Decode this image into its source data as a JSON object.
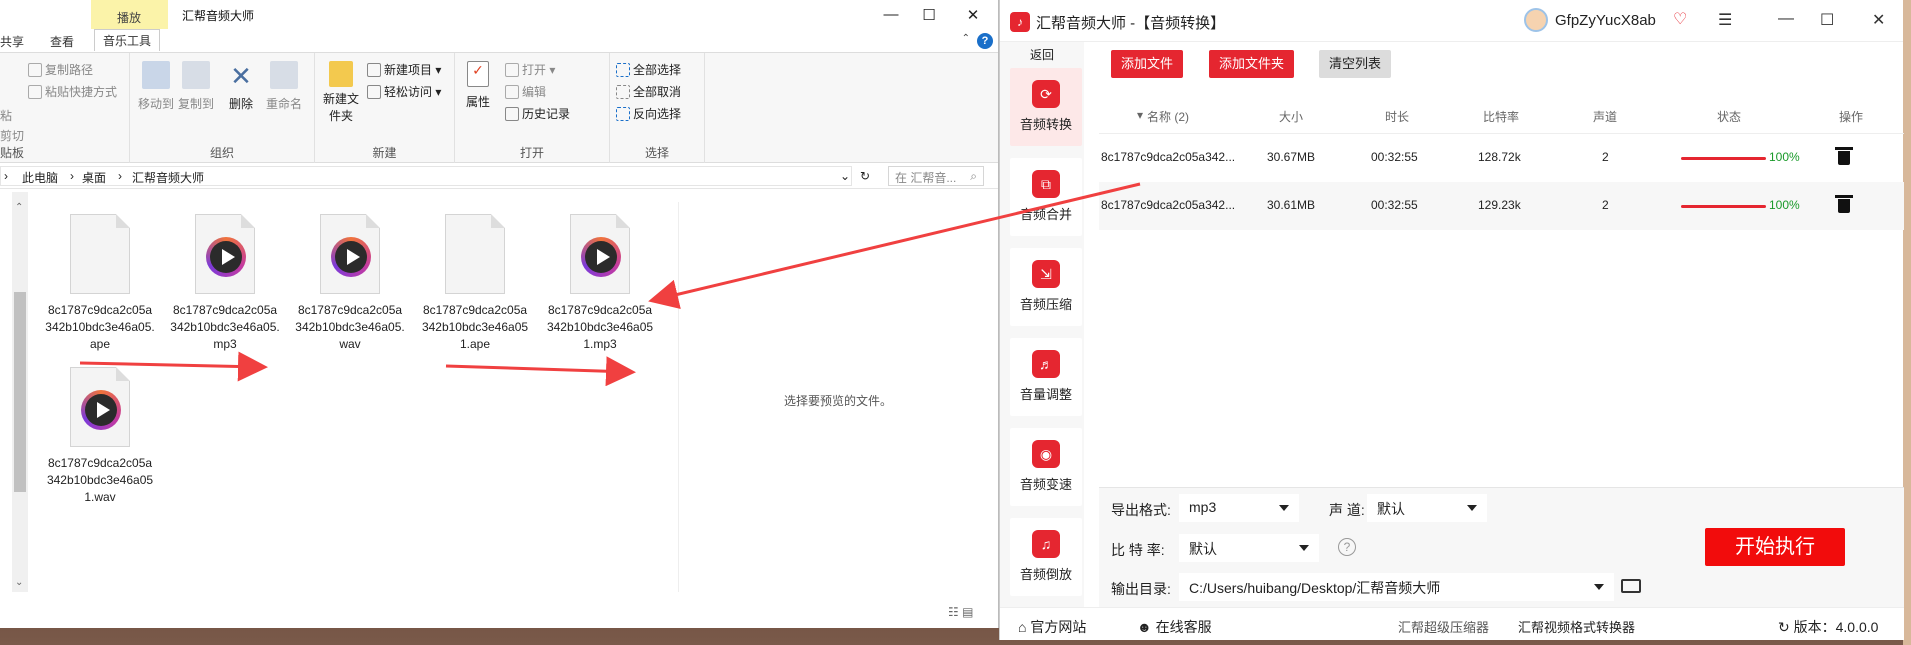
{
  "explorer": {
    "title": "汇帮音频大师",
    "context_tab": "播放",
    "tabs": [
      "共享",
      "查看",
      "音乐工具"
    ],
    "ribbon": {
      "clipboard": {
        "label": "贴板",
        "items": [
          "复制路径",
          "粘贴快捷方式",
          "粘",
          "剪切"
        ]
      },
      "organize": {
        "label": "组织",
        "items": [
          "移动到",
          "复制到",
          "删除",
          "重命名"
        ]
      },
      "new": {
        "label": "新建",
        "items": [
          "新建文件夹",
          "新建项目",
          "轻松访问"
        ]
      },
      "open": {
        "label": "打开",
        "items": [
          "属性",
          "打开",
          "编辑",
          "历史记录"
        ]
      },
      "select": {
        "label": "选择",
        "items": [
          "全部选择",
          "全部取消",
          "反向选择"
        ]
      }
    },
    "breadcrumb": [
      "此电脑",
      "桌面",
      "汇帮音频大师"
    ],
    "search_placeholder": "在 汇帮音...",
    "files": [
      {
        "name": "8c1787c9dca2c05a342b10bdc3e46a05.ape",
        "icon": "generic-file-icon"
      },
      {
        "name": "8c1787c9dca2c05a342b10bdc3e46a05.mp3",
        "icon": "media-play-icon"
      },
      {
        "name": "8c1787c9dca2c05a342b10bdc3e46a05.wav",
        "icon": "media-play-icon"
      },
      {
        "name": "8c1787c9dca2c05a342b10bdc3e46a051.ape",
        "icon": "generic-file-icon"
      },
      {
        "name": "8c1787c9dca2c05a342b10bdc3e46a051.mp3",
        "icon": "media-play-icon"
      },
      {
        "name": "8c1787c9dca2c05a342b10bdc3e46a051.wav",
        "icon": "media-play-icon"
      }
    ],
    "preview_text": "选择要预览的文件。"
  },
  "app": {
    "title": "汇帮音频大师 -【音频转换】",
    "user": "GfpZyYucX8ab",
    "sidebar": {
      "back": "返回",
      "items": [
        {
          "label": "音频转换",
          "active": true
        },
        {
          "label": "音频合并",
          "active": false
        },
        {
          "label": "音频压缩",
          "active": false
        },
        {
          "label": "音量调整",
          "active": false
        },
        {
          "label": "音频变速",
          "active": false
        },
        {
          "label": "音频倒放",
          "active": false
        }
      ]
    },
    "toolbar": {
      "add_file": "添加文件",
      "add_folder": "添加文件夹",
      "clear": "清空列表"
    },
    "table": {
      "headers": [
        "名称 (2)",
        "大小",
        "时长",
        "比特率",
        "声道",
        "状态",
        "操作"
      ],
      "rows": [
        {
          "name": "8c1787c9dca2c05a342...",
          "size": "30.67MB",
          "duration": "00:32:55",
          "bitrate": "128.72k",
          "channels": "2",
          "progress": "100%"
        },
        {
          "name": "8c1787c9dca2c05a342...",
          "size": "30.61MB",
          "duration": "00:32:55",
          "bitrate": "129.23k",
          "channels": "2",
          "progress": "100%"
        }
      ]
    },
    "settings": {
      "format_label": "导出格式:",
      "format_value": "mp3",
      "channel_label": "声 道:",
      "channel_value": "默认",
      "bitrate_label": "比 特 率:",
      "bitrate_value": "默认",
      "output_label": "输出目录:",
      "output_value": "C:/Users/huibang/Desktop/汇帮音频大师",
      "start": "开始执行"
    },
    "footer": {
      "website": "官方网站",
      "service": "在线客服",
      "link1": "汇帮超级压缩器",
      "link2": "汇帮视频格式转换器",
      "version": "版本：4.0.0.0"
    },
    "accent_color": "#e52630"
  }
}
